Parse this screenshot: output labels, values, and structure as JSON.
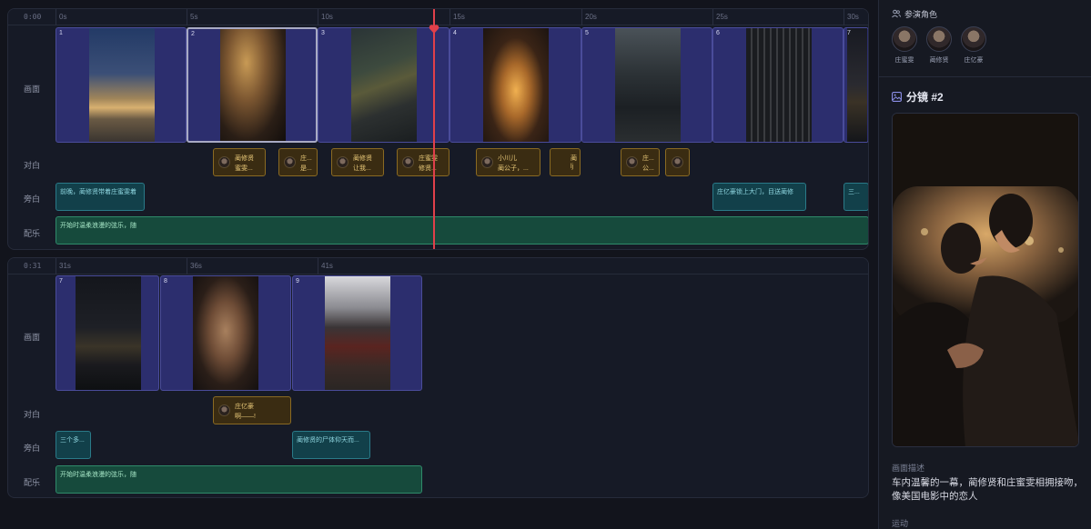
{
  "row1": {
    "timecode": "0:00",
    "ticks": [
      "0s",
      "5s",
      "10s",
      "15s",
      "20s",
      "25s",
      "30s"
    ],
    "tracks": [
      "画面",
      "对白",
      "旁白",
      "配乐"
    ],
    "clips": [
      "1",
      "2",
      "3",
      "4",
      "5",
      "6",
      "7"
    ],
    "dialogues": [
      {
        "name": "蔺修贤",
        "text": "蜜雯..."
      },
      {
        "name": "庄...",
        "text": "是..."
      },
      {
        "name": "蔺修贤",
        "text": "让我..."
      },
      {
        "name": "庄蜜雯",
        "text": "修贤..."
      },
      {
        "name": "小川儿",
        "text": "蔺公子，..."
      },
      {
        "name": "蔺",
        "text": "lj"
      },
      {
        "name": "庄...",
        "text": "公..."
      },
      {
        "name": "",
        "text": ""
      }
    ],
    "narrations": [
      "前晚，蔺修贤带着庄蜜雯着",
      "庄亿豪锁上大门，目送蔺修",
      "三..."
    ],
    "music": "开始时温柔浪漫的弦乐，随"
  },
  "row2": {
    "timecode": "0:31",
    "ticks": [
      "31s",
      "36s",
      "41s"
    ],
    "tracks": [
      "画面",
      "对白",
      "旁白",
      "配乐"
    ],
    "clips": [
      "7",
      "8",
      "9"
    ],
    "dialogues": [
      {
        "name": "庄亿豪",
        "text": "啊——!"
      }
    ],
    "narrations": [
      "三个多...",
      "蔺修贤的尸体仰天而..."
    ],
    "music": "开始时温柔浪漫的弦乐，随"
  },
  "sidebar": {
    "cast_title": "参演角色",
    "actors": [
      "庄蜜雯",
      "蔺修贤",
      "庄亿豪"
    ],
    "shot_title": "分镜 #2",
    "desc_label": "画面描述",
    "desc_value": "车内温馨的一幕，蔺修贤和庄蜜雯相拥接吻，像美国电影中的恋人",
    "motion_label": "运动"
  },
  "colors": {
    "playhead": "#e0404a",
    "clip": "#2c2e6e",
    "dialogue": "#3a2c12",
    "narration": "#12404a",
    "music": "#164a3c"
  }
}
